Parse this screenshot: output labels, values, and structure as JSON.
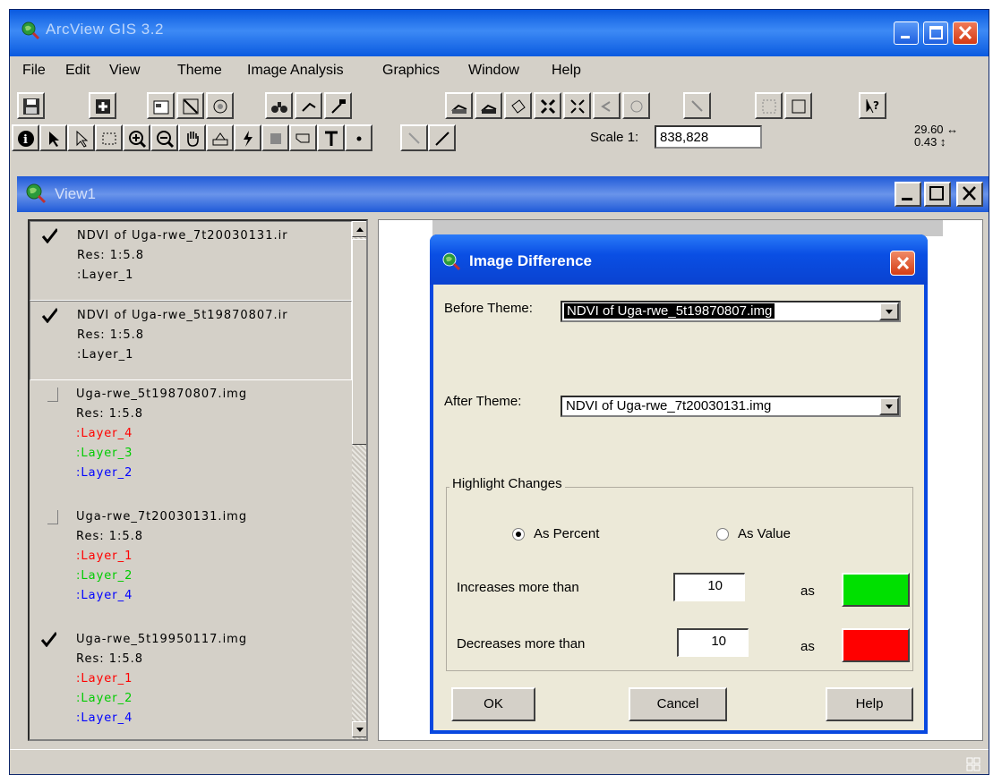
{
  "app": {
    "title": "ArcView GIS 3.2",
    "menu": [
      "File",
      "Edit",
      "View",
      "Theme",
      "Image Analysis",
      "Graphics",
      "Window",
      "Help"
    ],
    "scale_label": "Scale 1:",
    "scale_value": "838,828",
    "coord_x": "29.60 ↔",
    "coord_y": "0.43 ↕"
  },
  "view": {
    "title": "View1",
    "themes": [
      {
        "checked": true,
        "active": true,
        "name": "NDVI of Uga-rwe_7t20030131.ir",
        "res": "Res: 1:5.8",
        "layers": [
          {
            "label": ":Layer_1",
            "color": "black"
          }
        ]
      },
      {
        "checked": true,
        "active": true,
        "name": "NDVI of Uga-rwe_5t19870807.ir",
        "res": "Res: 1:5.8",
        "layers": [
          {
            "label": ":Layer_1",
            "color": "black"
          }
        ]
      },
      {
        "checked": false,
        "active": false,
        "name": "Uga-rwe_5t19870807.img",
        "res": "Res: 1:5.8",
        "layers": [
          {
            "label": ":Layer_4",
            "color": "red"
          },
          {
            "label": ":Layer_3",
            "color": "green"
          },
          {
            "label": ":Layer_2",
            "color": "blue"
          }
        ]
      },
      {
        "checked": false,
        "active": false,
        "name": "Uga-rwe_7t20030131.img",
        "res": "Res: 1:5.8",
        "layers": [
          {
            "label": ":Layer_1",
            "color": "red"
          },
          {
            "label": ":Layer_2",
            "color": "green"
          },
          {
            "label": ":Layer_4",
            "color": "blue"
          }
        ]
      },
      {
        "checked": true,
        "active": false,
        "name": "Uga-rwe_5t19950117.img",
        "res": "Res: 1:5.8",
        "layers": [
          {
            "label": ":Layer_1",
            "color": "red"
          },
          {
            "label": ":Layer_2",
            "color": "green"
          },
          {
            "label": ":Layer_4",
            "color": "blue"
          }
        ]
      }
    ]
  },
  "dialog": {
    "title": "Image Difference",
    "before_label": "Before Theme:",
    "before_value": "NDVI of Uga-rwe_5t19870807.img",
    "after_label": "After Theme:",
    "after_value": "NDVI of Uga-rwe_7t20030131.img",
    "group_title": "Highlight Changes",
    "radio_percent": "As Percent",
    "radio_value": "As Value",
    "selected_mode": "percent",
    "increase_label": "Increases more than",
    "increase_value": "10",
    "decrease_label": "Decreases more than",
    "decrease_value": "10",
    "as_label": "as",
    "increase_color": "#00e000",
    "decrease_color": "#ff0000",
    "ok": "OK",
    "cancel": "Cancel",
    "help": "Help"
  }
}
